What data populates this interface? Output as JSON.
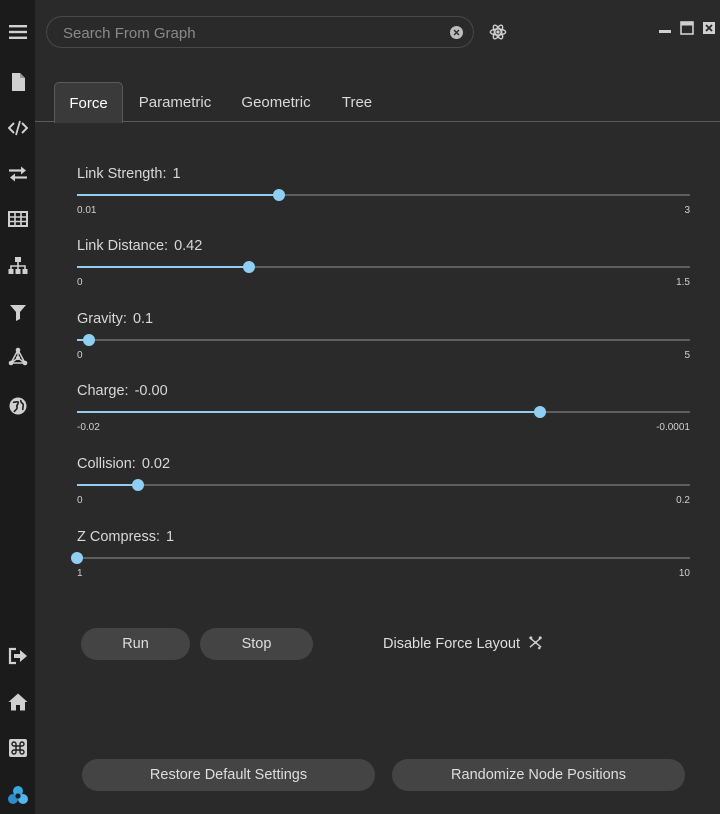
{
  "search": {
    "placeholder": "Search From Graph",
    "value": ""
  },
  "tabs": [
    {
      "label": "Force",
      "active": true
    },
    {
      "label": "Parametric",
      "active": false
    },
    {
      "label": "Geometric",
      "active": false
    },
    {
      "label": "Tree",
      "active": false
    }
  ],
  "sliders": [
    {
      "label": "Link Strength:",
      "value": "1",
      "min": "0.01",
      "max": "3",
      "fraction": 0.33
    },
    {
      "label": "Link Distance:",
      "value": "0.42",
      "min": "0",
      "max": "1.5",
      "fraction": 0.28
    },
    {
      "label": "Gravity:",
      "value": "0.1",
      "min": "0",
      "max": "5",
      "fraction": 0.02
    },
    {
      "label": "Charge:",
      "value": "-0.00",
      "min": "-0.02",
      "max": "-0.0001",
      "fraction": 0.755
    },
    {
      "label": "Collision:",
      "value": "0.02",
      "min": "0",
      "max": "0.2",
      "fraction": 0.1
    },
    {
      "label": "Z Compress:",
      "value": "1",
      "min": "1",
      "max": "10",
      "fraction": 0.0
    }
  ],
  "buttons": {
    "run": "Run",
    "stop": "Stop",
    "restore": "Restore Default Settings",
    "randomize": "Randomize Node Positions"
  },
  "toggle": {
    "label": "Disable Force Layout",
    "icon": "scatter-toggle-icon"
  },
  "rail_icons": [
    "menu-icon",
    "file-icon",
    "code-icon",
    "swap-icon",
    "table-icon",
    "hierarchy-icon",
    "filter-icon",
    "network-icon",
    "globe-icon",
    "logout-icon",
    "home-icon",
    "command-icon",
    "app-logo-icon"
  ],
  "colors": {
    "accent": "#8fcff2",
    "background": "#2a2a2a",
    "rail": "#1b1b1b",
    "button": "#444444"
  }
}
